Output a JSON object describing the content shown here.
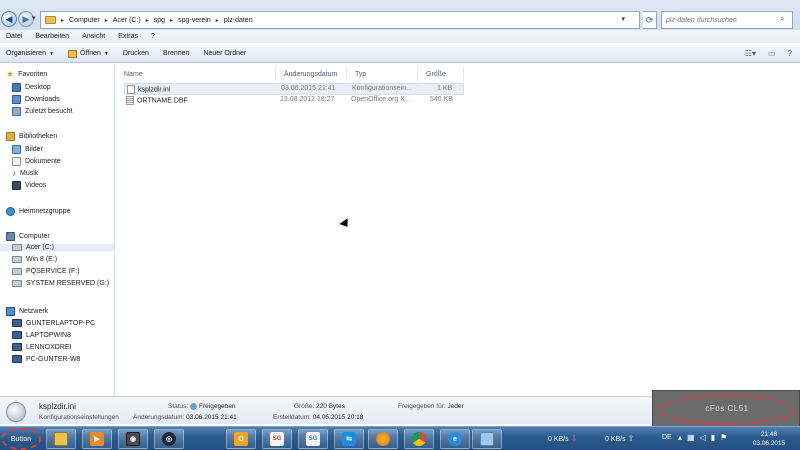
{
  "address_bar": {
    "breadcrumb": [
      "Computer",
      "Acer (C:)",
      "spg",
      "spg-verein",
      "plz-daten"
    ],
    "search_placeholder": "plz-daten durchsuchen"
  },
  "menu": [
    "Datei",
    "Bearbeiten",
    "Ansicht",
    "Extras",
    "?"
  ],
  "toolbar": {
    "organize": "Organisieren",
    "open": "Öffnen",
    "print": "Drucken",
    "burn": "Brennen",
    "new_folder": "Neuer Ordner"
  },
  "sidebar": {
    "favorites": {
      "label": "Favoriten",
      "items": [
        "Desktop",
        "Downloads",
        "Zuletzt besucht"
      ]
    },
    "libraries": {
      "label": "Bibliotheken",
      "items": [
        "Bilder",
        "Dokumente",
        "Musik",
        "Videos"
      ]
    },
    "homegroup": {
      "label": "Heimnetzgruppe"
    },
    "computer": {
      "label": "Computer",
      "items": [
        "Acer (C:)",
        "Win 8 (E:)",
        "PQSERVICE (F:)",
        "SYSTEM RESERVED (G:)"
      ]
    },
    "network": {
      "label": "Netzwerk",
      "items": [
        "GUNTERLAPTOP-PC",
        "LAPTOPWIN8",
        "LENNOXDREI",
        "PC-GUNTER-W8"
      ]
    }
  },
  "file_list": {
    "columns": [
      "Name",
      "Änderungsdatum",
      "Typ",
      "Größe"
    ],
    "rows": [
      {
        "name": "ksplzdir.ini",
        "date": "03.06.2015 21:41",
        "type": "Konfigurationsein...",
        "size": "1 KB"
      },
      {
        "name": "ORTNAME.DBF",
        "date": "13.08.2012 18:27",
        "type": "OpenOffice.org X...",
        "size": "540 KB"
      }
    ]
  },
  "details": {
    "name": "ksplzdir.ini",
    "type": "Konfigurationseinstellungen",
    "status_label": "Status:",
    "status_value": "Freigegeben",
    "modified_label": "Änderungsdatum:",
    "modified_value": "03.06.2015 21:41",
    "size_label": "Größe:",
    "size_value": "220 Bytes",
    "created_label": "Erstelldatum:",
    "created_value": "04.05.2015 20:18",
    "shared_label": "Freigegeben für:",
    "shared_value": "Jeder"
  },
  "overlay": {
    "label": "cFos CL51"
  },
  "taskbar": {
    "start_label": "Button",
    "apps": [
      "folder-icon",
      "media-player-icon",
      "camera-icon",
      "steam-icon",
      "outlook-icon",
      "sg-icon",
      "sg-icon",
      "teamviewer-icon",
      "firefox-icon",
      "chrome-icon",
      "ie-icon",
      "explorer-icon"
    ],
    "net_down": "0 KB/s",
    "net_up": "0 KB/s",
    "lang": "DE",
    "time": "21:48",
    "date": "03.06.2015"
  }
}
